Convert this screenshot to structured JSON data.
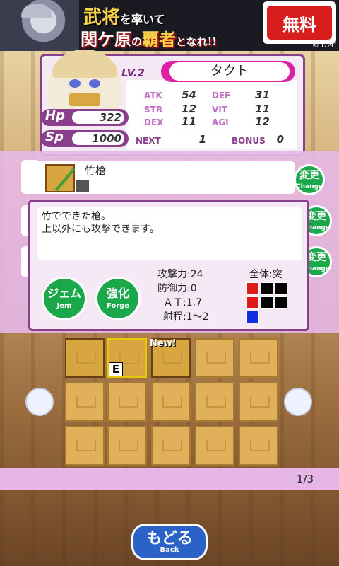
{
  "banner": {
    "line1_main": "武将",
    "line1_small": "を率いて",
    "line2_main": "関ケ原",
    "line2_small_1": "の",
    "line2_highlight": "覇者",
    "line2_small_2": "となれ!!",
    "free_label": "無料",
    "copyright": "© D2C"
  },
  "character": {
    "level_label": "LV.2",
    "name": "タクト",
    "hp_label": "Hp",
    "hp_value": "322",
    "sp_label": "Sp",
    "sp_value": "1000",
    "stats": {
      "atk_label": "ATK",
      "atk": "54",
      "def_label": "DEF",
      "def": "31",
      "str_label": "STR",
      "str": "12",
      "vit_label": "VIT",
      "vit": "11",
      "dex_label": "DEX",
      "dex": "11",
      "agi_label": "AGI",
      "agi": "12",
      "next_label": "NEXT",
      "next": "1",
      "bonus_label": "BONUS",
      "bonus": "0"
    }
  },
  "equipment": {
    "weapon_name": "竹槍",
    "change_label": "変更",
    "change_sub": "Change"
  },
  "popup": {
    "desc_line1": "竹でできた槍。",
    "desc_line2": "上以外にも攻撃できます。",
    "gem_label": "ジェム",
    "gem_sub": "Jem",
    "forge_label": "強化",
    "forge_sub": "Forge",
    "attack_label": "攻撃力",
    "attack_value": ":24",
    "defense_label": "防御力",
    "defense_value": ":0",
    "at_label": "ＡＴ",
    "at_value": ":1.7",
    "range_label": "射程",
    "range_value": ":1〜2",
    "target_label": "全体:突",
    "grid_colors": [
      "#e01818",
      "#000000",
      "#000000",
      "#e01818",
      "#000000",
      "#000000",
      "#1030e0"
    ]
  },
  "inventory": {
    "new_badge": "New!",
    "equipped_marker": "E",
    "page": "1/3"
  },
  "back": {
    "label": "もどる",
    "sub": "Back"
  }
}
